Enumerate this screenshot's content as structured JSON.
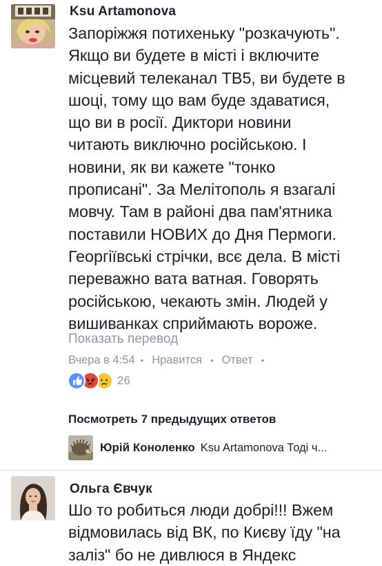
{
  "comment1": {
    "author": "Ksu Artamonova",
    "text": "Запоріжжя потихеньку \"розкачують\".\nЯкщо ви будете в місті і включите\nмісцевий телеканал ТВ5, ви будете в\nшоці, тому що вам буде здаватися,\nщо ви в росії. Диктори новини\nчитають  виключно  російською. І\nновини, як ви кажете \"тонко\nпрописані\". За Мелітополь я взагалі\nмовчу. Там в районі два пам'ятника\nпоставили НОВИХ до Дня Пермоги.\nГеоргіївські стрічки, всє дела. В місті\nпереважно вата ватная. Говорять\nросійською, чекають змін. Людей у\nвишиванках сприймають вороже.",
    "translate_label": "Показать перевод",
    "time": "Вчера в 4:54",
    "like_label": "Нравится",
    "reply_label": "Ответ",
    "reaction_count": "26",
    "reactions": [
      "like-icon",
      "angry-icon",
      "sad-icon"
    ],
    "view_previous_label": "Посмотреть 7 предыдущих ответов",
    "reply_preview": {
      "author": "Юрій Коноленко",
      "snippet": "Ksu Artamonova Тоді ч..."
    }
  },
  "comment2": {
    "author": "Ольга Євчук",
    "text": "Шо то робиться люди добрі!!! Вжем\nвідмовилась від ВК, по Києву їду \"на\nзаліз\" бо не дивлюся в Яндекс"
  },
  "colors": {
    "text": "#1d2129",
    "meta": "#90949c",
    "like_blue": "#5890ff",
    "angry_red": "#e0473d",
    "sad_yellow": "#f7c537"
  }
}
